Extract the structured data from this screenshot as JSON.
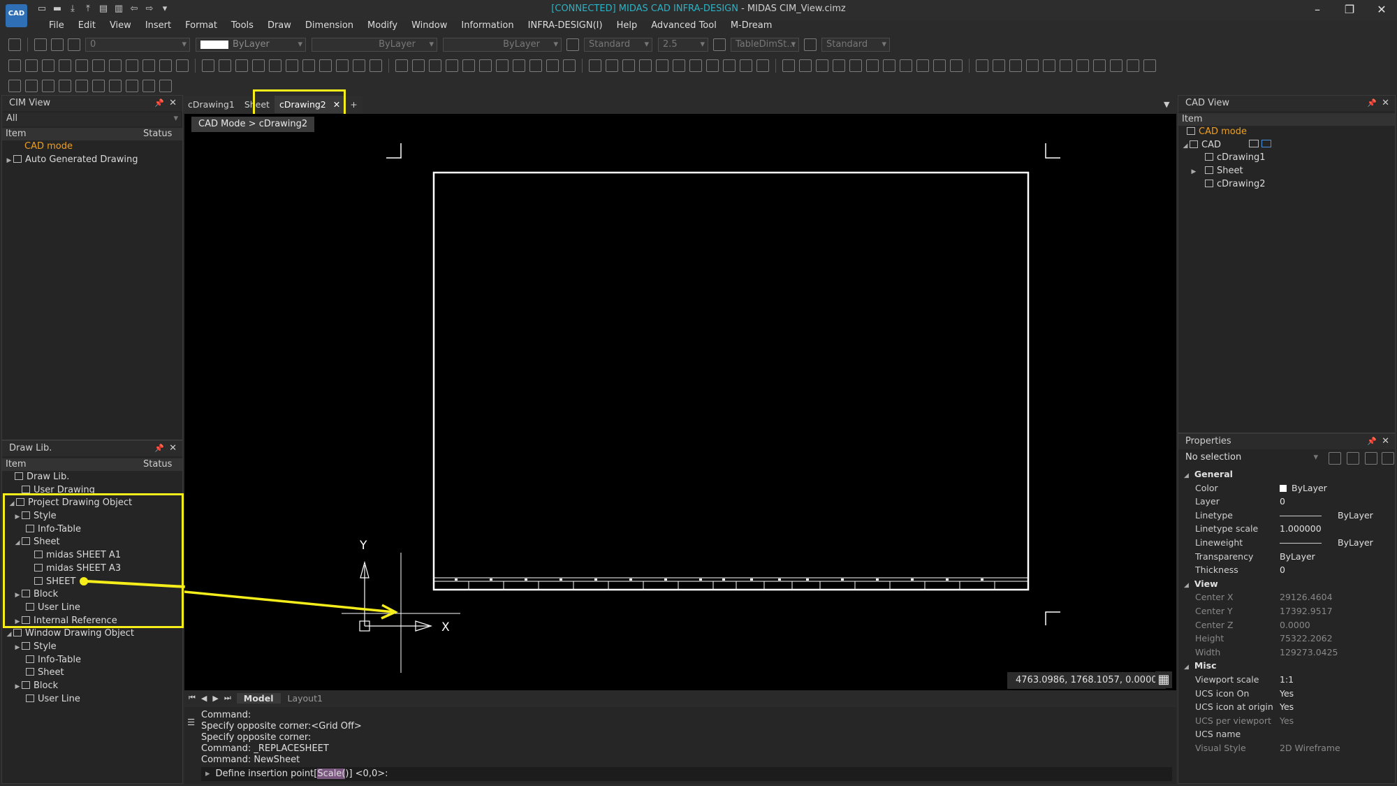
{
  "window": {
    "connected": "[CONNECTED] MIDAS CAD INFRA-DESIGN",
    "file": " - MIDAS CIM_View.cimz",
    "logo": "CAD"
  },
  "menu": [
    "File",
    "Edit",
    "View",
    "Insert",
    "Format",
    "Tools",
    "Draw",
    "Dimension",
    "Modify",
    "Window",
    "Information",
    "INFRA-DESIGN(I)",
    "Help",
    "Advanced Tool",
    "M-Dream"
  ],
  "toolbar": {
    "layer_value": "0",
    "color_value": "ByLayer",
    "linetype_value": "ByLayer",
    "lineweight_value": "ByLayer",
    "text_style": "Standard",
    "text_height": "2.5",
    "dim_style": "TableDimSt...",
    "plot_style": "Standard"
  },
  "cim_view": {
    "title": "CIM View",
    "filter": "All",
    "col_item": "Item",
    "col_status": "Status",
    "items": [
      "CAD mode",
      "Auto Generated Drawing"
    ]
  },
  "draw_lib": {
    "title": "Draw Lib.",
    "col_item": "Item",
    "col_status": "Status",
    "items": [
      "Draw Lib.",
      "User Drawing",
      "Project Drawing Object",
      "Style",
      "Info-Table",
      "Sheet",
      "midas SHEET A1",
      "midas SHEET A3",
      "SHEET",
      "Block",
      "User Line",
      "Internal Reference",
      "Window Drawing Object",
      "Style",
      "Info-Table",
      "Sheet",
      "Block",
      "User Line"
    ]
  },
  "doc_tabs": [
    "cDrawing1",
    "Sheet",
    "cDrawing2"
  ],
  "breadcrumb": "CAD Mode > cDrawing2",
  "coords": "4763.0986, 1768.1057, 0.0000",
  "ucs": {
    "y": "Y",
    "x": "X"
  },
  "layout_tabs": [
    "Model",
    "Layout1"
  ],
  "command_history": [
    "Command:",
    "Specify opposite corner:<Grid Off>",
    "Specify opposite corner:",
    "Command:  _REPLACESHEET",
    "Command:  NewSheet"
  ],
  "command_prompt": {
    "before": "Define insertion point[",
    "highlight": "Scale(",
    "after": ")] <0,0>:"
  },
  "cad_view": {
    "title": "CAD View",
    "col_item": "Item",
    "items": [
      "CAD mode",
      "CAD",
      "cDrawing1",
      "Sheet",
      "cDrawing2"
    ]
  },
  "properties": {
    "title": "Properties",
    "selection": "No selection",
    "sections": {
      "general": "General",
      "view": "View",
      "misc": "Misc"
    },
    "general": [
      {
        "name": "Color",
        "value": "ByLayer"
      },
      {
        "name": "Layer",
        "value": "0"
      },
      {
        "name": "Linetype",
        "value": "ByLayer"
      },
      {
        "name": "Linetype scale",
        "value": "1.000000"
      },
      {
        "name": "Lineweight",
        "value": "ByLayer"
      },
      {
        "name": "Transparency",
        "value": "ByLayer"
      },
      {
        "name": "Thickness",
        "value": "0"
      }
    ],
    "view": [
      {
        "name": "Center X",
        "value": "29126.4604"
      },
      {
        "name": "Center Y",
        "value": "17392.9517"
      },
      {
        "name": "Center Z",
        "value": "0.0000"
      },
      {
        "name": "Height",
        "value": "75322.2062"
      },
      {
        "name": "Width",
        "value": "129273.0425"
      }
    ],
    "misc": [
      {
        "name": "Viewport scale",
        "value": "1:1"
      },
      {
        "name": "UCS icon On",
        "value": "Yes"
      },
      {
        "name": "UCS icon at origin",
        "value": "Yes"
      },
      {
        "name": "UCS per viewport",
        "value": "Yes"
      },
      {
        "name": "UCS name",
        "value": ""
      },
      {
        "name": "Visual Style",
        "value": "2D Wireframe"
      }
    ]
  },
  "colors": {
    "accent_yellow": "#f5ee1a",
    "cad_mode_orange": "#f0a020",
    "connected_cyan": "#2ab3c6"
  }
}
